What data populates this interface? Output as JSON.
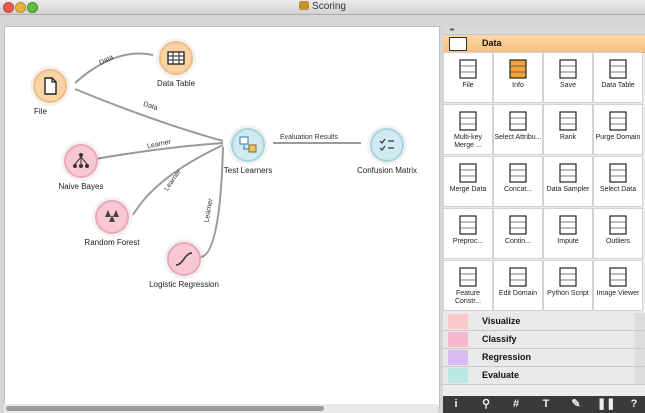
{
  "window": {
    "title": "Scoring"
  },
  "canvas": {
    "nodes": {
      "file": "File",
      "data_table": "Data Table",
      "naive_bayes": "Naive Bayes",
      "random_forest": "Random Forest",
      "logistic_regression": "Logistic Regression",
      "test_learners": "Test Learners",
      "confusion_matrix": "Confusion Matrix"
    },
    "links": {
      "file_to_table": "Data",
      "file_to_test": "Data",
      "nb_to_test": "Learner",
      "rf_to_test": "Learner",
      "lr_to_test": "Learner",
      "test_to_cm": "Evaluation Results"
    }
  },
  "toolbox": {
    "active_category": "Data",
    "widgets": [
      "File",
      "Info",
      "Save",
      "Data Table",
      "Multi-key Merge ...",
      "Select Attribu...",
      "Rank",
      "Purge Domain",
      "Merge Data",
      "Concat...",
      "Data Sampler",
      "Select Data",
      "Preproc...",
      "Contin...",
      "Impute",
      "Outliers",
      "Feature Constr...",
      "Edit Domain",
      "Python Script",
      "Image Viewer"
    ],
    "categories": [
      {
        "label": "Visualize",
        "color": "#f9c8c8"
      },
      {
        "label": "Classify",
        "color": "#f6b8cf"
      },
      {
        "label": "Regression",
        "color": "#d8b9f0"
      },
      {
        "label": "Evaluate",
        "color": "#b9e9e2"
      }
    ]
  },
  "colors": {
    "data_accent": "#f7c07f",
    "learner_node": "#f8c8d3",
    "eval_node": "#cfeaf0"
  },
  "bottom_toolbar": [
    "info-icon",
    "search-icon",
    "hash-icon",
    "text-icon",
    "pencil-icon",
    "pause-icon",
    "help-icon"
  ]
}
